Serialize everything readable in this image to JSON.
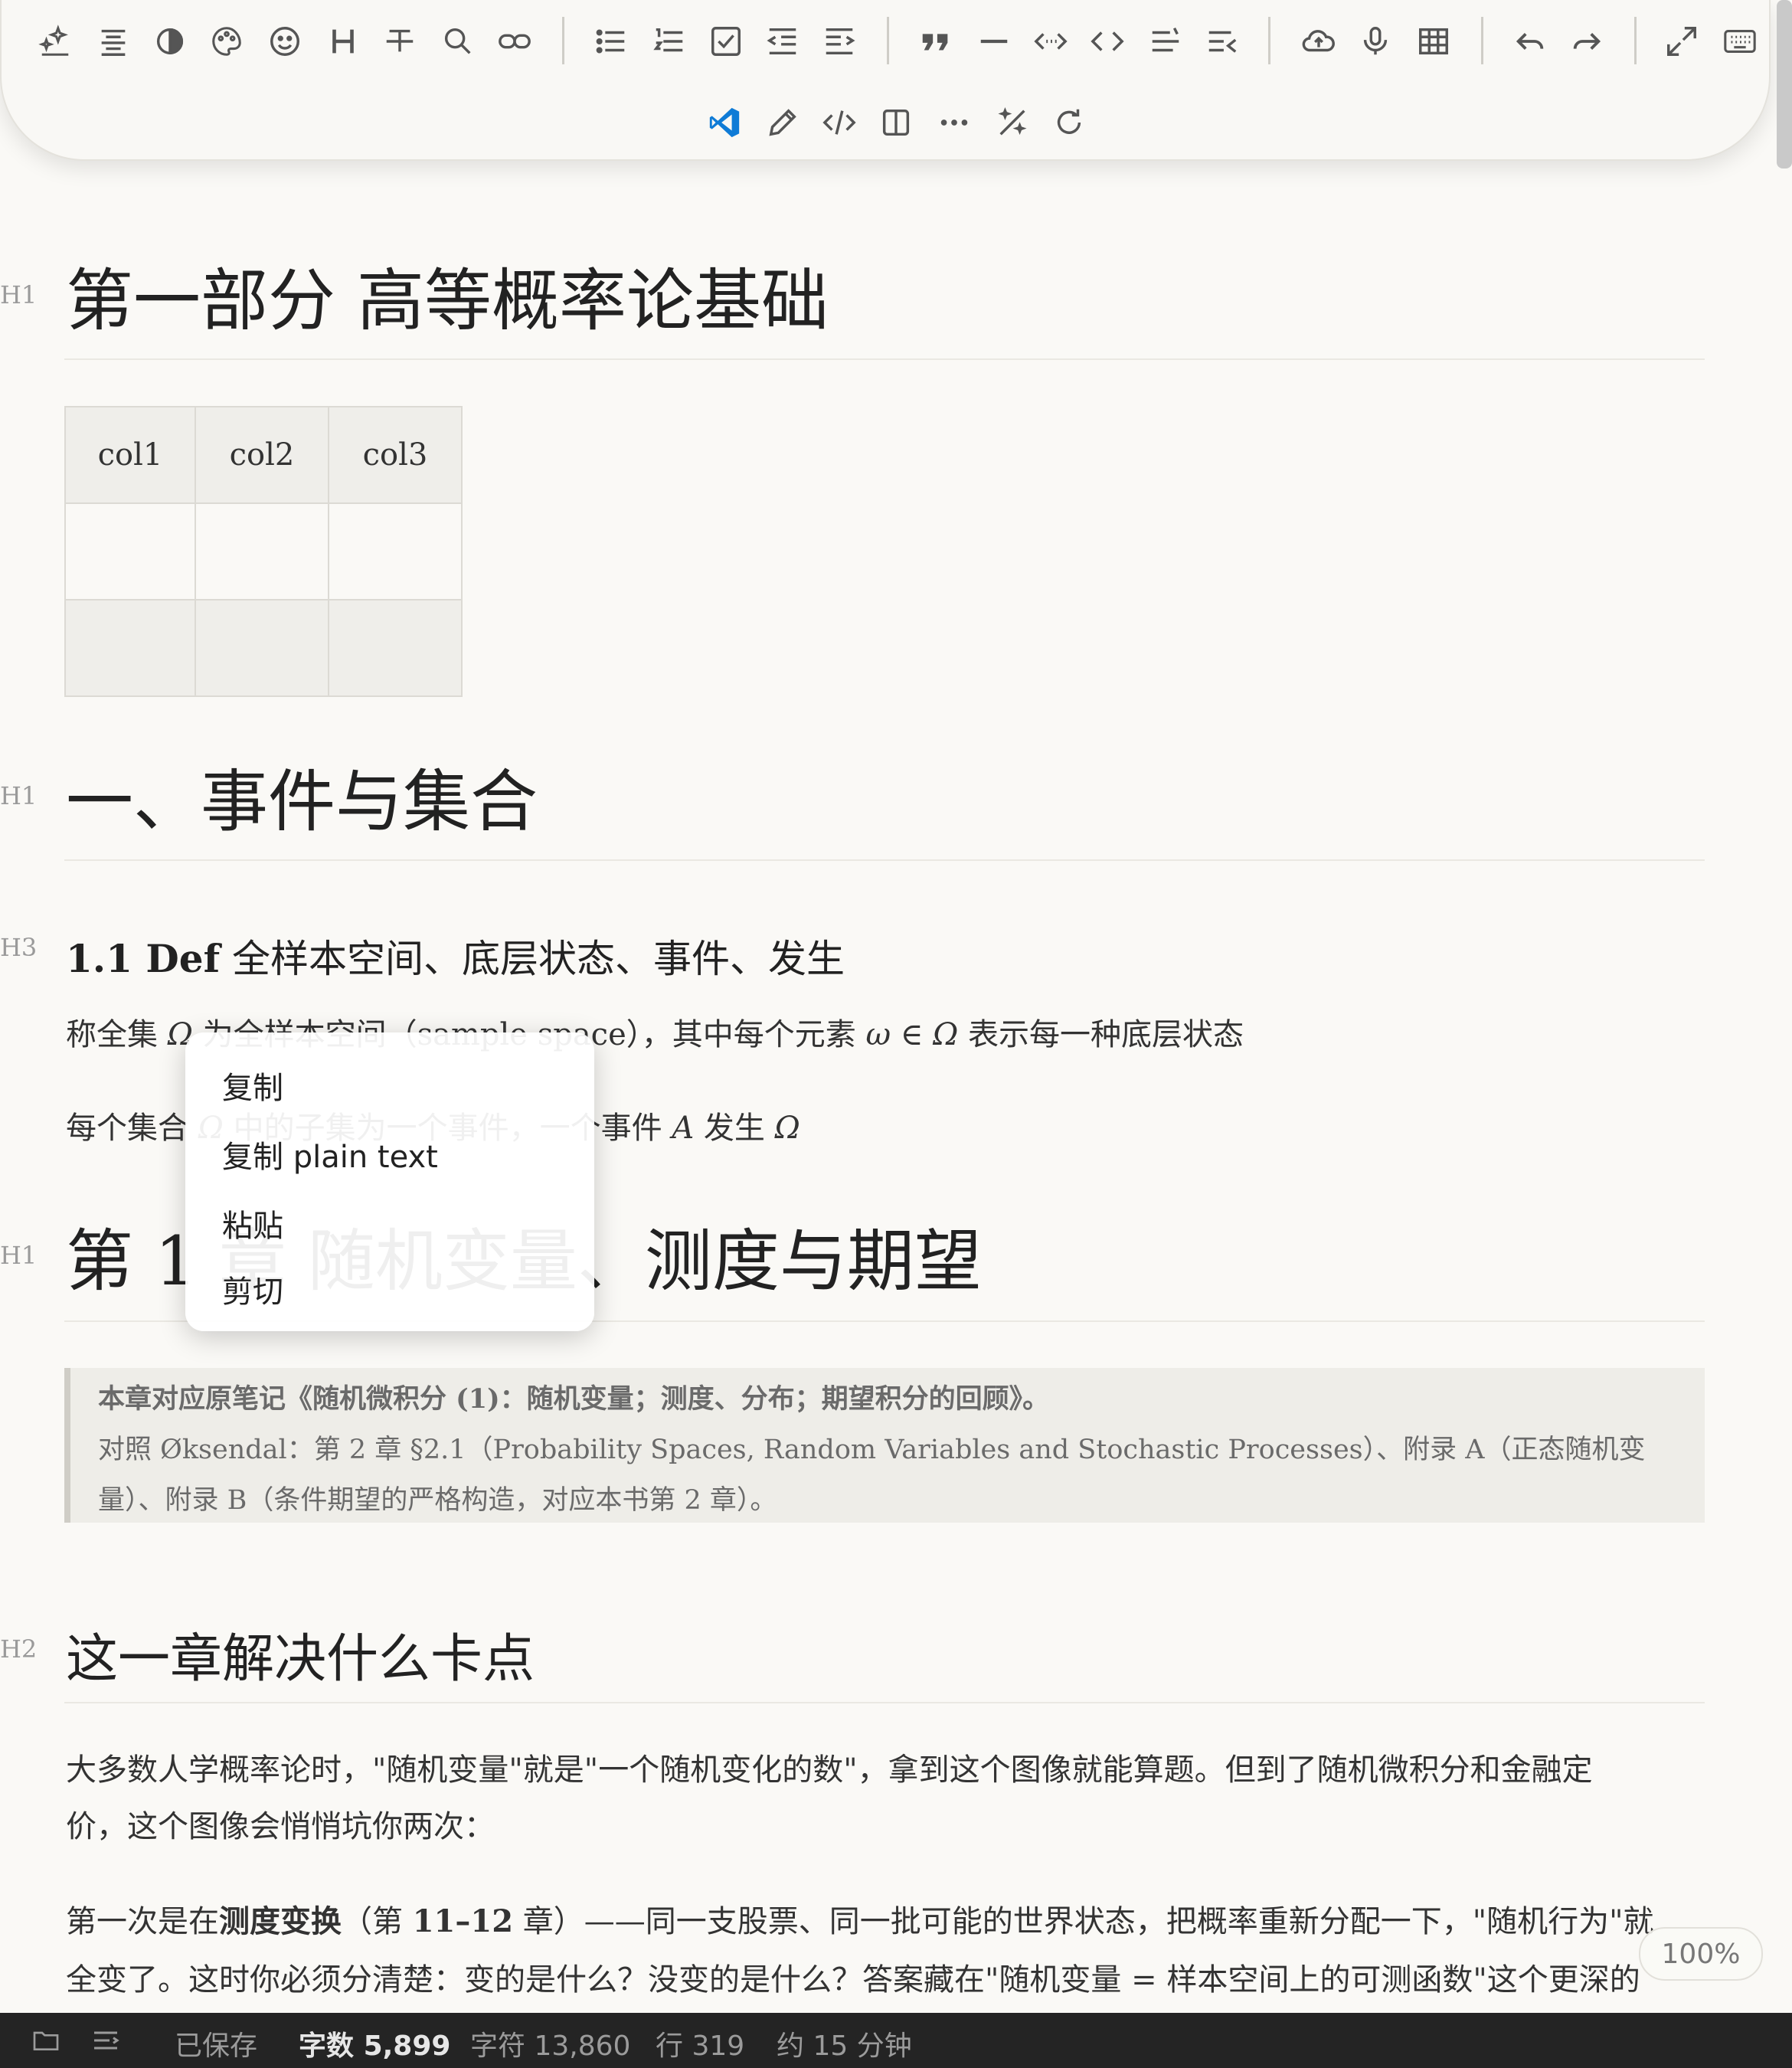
{
  "toolbar": {
    "row1_icons": [
      "sparkle-icon",
      "align-icon",
      "contrast-icon",
      "palette-icon",
      "emoji-icon",
      "heading-icon",
      "strikethrough-icon",
      "search-icon",
      "link-icon",
      "bullet-list-icon",
      "numbered-list-icon",
      "checkbox-list-icon",
      "outdent-icon",
      "indent-icon",
      "quote-icon",
      "horizontal-rule-icon",
      "inline-code-icon",
      "code-block-icon",
      "align-left-icon",
      "align-right-icon",
      "upload-icon",
      "microphone-icon",
      "table-icon",
      "undo-icon",
      "redo-icon",
      "fullscreen-icon",
      "keyboard-icon"
    ],
    "row2_icons": [
      "vscode-icon",
      "pencil-icon",
      "source-code-icon",
      "split-view-icon",
      "more-icon",
      "magic-icon",
      "refresh-icon"
    ],
    "accent": "#0f7bd6"
  },
  "document": {
    "h1_part": "第一部分 高等概率论基础",
    "table": {
      "headers": [
        "col1",
        "col2",
        "col3"
      ],
      "rows": [
        [
          "",
          "",
          ""
        ],
        [
          "",
          "",
          ""
        ]
      ]
    },
    "h1_sec1": "一、事件与集合",
    "h3_def": {
      "num": "1.1 Def",
      "text": " 全样本空间、底层状态、事件、发生"
    },
    "p1": {
      "a": "称全集 ",
      "omega": "Ω",
      "b": " 为全样本空间（sample space），其中每个元素 ",
      "w": "ω",
      "c": " ∈ ",
      "omega2": "Ω",
      "d": " 表示每一种底层状态"
    },
    "p2": {
      "a": "每个集合 ",
      "omega": "Ω",
      "b": " 中的子集为一个事件，一个事件 ",
      "A": "A",
      "c": " 发生 ",
      "omega2": "Ω"
    },
    "h1_ch1": "第 1 章 随机变量、测度与期望",
    "quote": {
      "line1": "本章对应原笔记《随机微积分 (1)：随机变量；测度、分布；期望积分的回顾》。",
      "line2": "对照 Øksendal：第 2 章 §2.1（Probability Spaces, Random Variables and Stochastic Processes）、附录 A（正态随机变",
      "line3": "量）、附录 B（条件期望的严格构造，对应本书第 2 章）。"
    },
    "h2_stuck": "这一章解决什么卡点",
    "p3": {
      "line1": "大多数人学概率论时，\"随机变量\"就是\"一个随机变化的数\"，拿到这个图像就能算题。但到了随机微积分和金融定",
      "line2": "价，这个图像会悄悄坑你两次："
    },
    "p4": {
      "a": "第一次是在",
      "bold": "测度变换",
      "b": "（第 ",
      "bold2": "11–12",
      "c": " 章）——同一支股票、同一批可能的世界状态，把概率重新分配一下，\"随机行为\"就",
      "line2": "全变了。这时你必须分清楚：变的是什么？没变的是什么？答案藏在\"随机变量 = 样本空间上的可测函数\"这个更深的"
    }
  },
  "labels": {
    "h1": "H1",
    "h2": "H2",
    "h3": "H3"
  },
  "context_menu": {
    "items": [
      "复制",
      "复制 plain text",
      "粘贴",
      "剪切"
    ]
  },
  "status": {
    "saved": "已保存",
    "words_label": "字数",
    "words": "5,899",
    "chars": "字符 13,860",
    "lines": "行 319",
    "time": "约 15 分钟",
    "zoom": "100%"
  }
}
